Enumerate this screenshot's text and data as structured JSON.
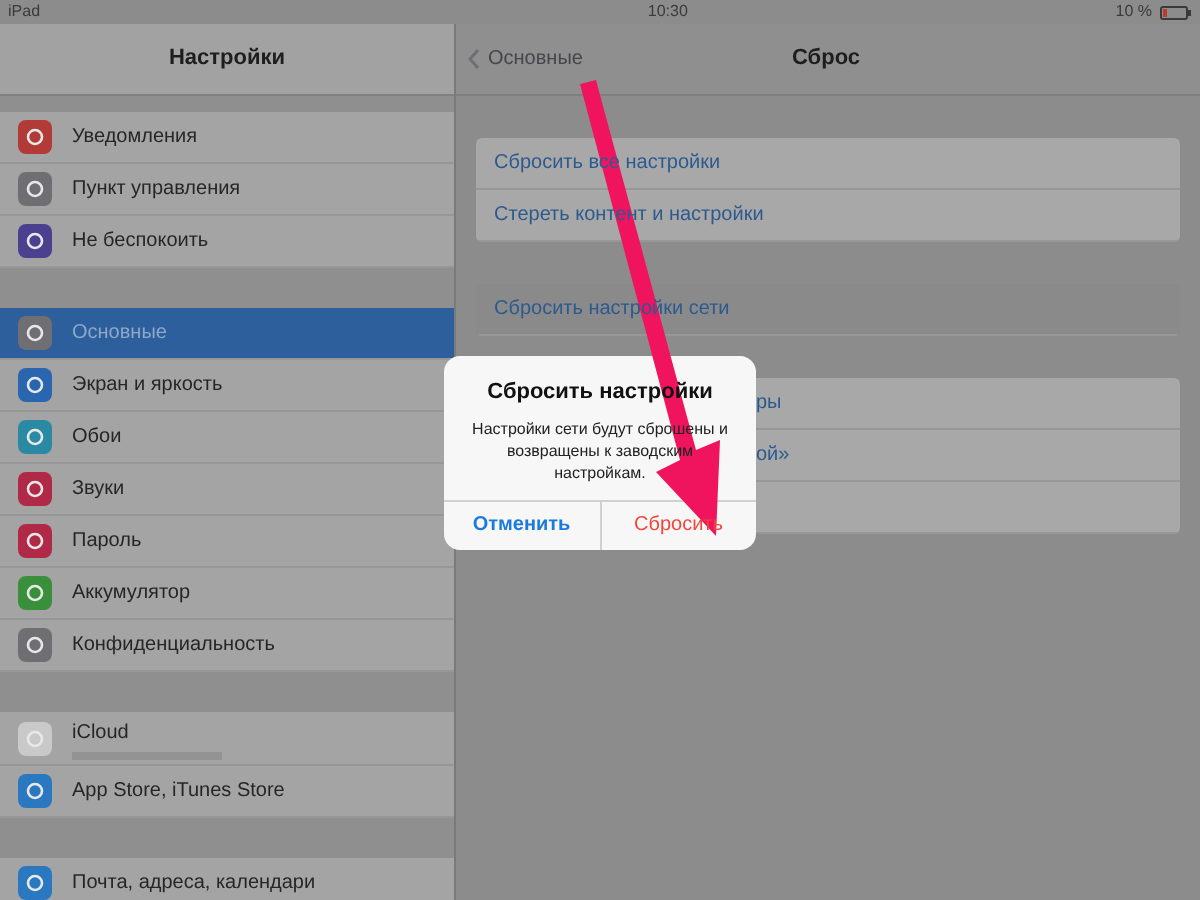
{
  "status_bar": {
    "device": "iPad",
    "time": "10:30",
    "battery": "10 %"
  },
  "sidebar": {
    "title": "Настройки",
    "groups": [
      [
        {
          "label": "Уведомления",
          "selected": false
        },
        {
          "label": "Пункт управления",
          "selected": false
        },
        {
          "label": "Не беспокоить",
          "selected": false
        }
      ],
      [
        {
          "label": "Основные",
          "selected": true
        },
        {
          "label": "Экран и яркость",
          "selected": false
        },
        {
          "label": "Обои",
          "selected": false
        },
        {
          "label": "Звуки",
          "selected": false
        },
        {
          "label": "Пароль",
          "selected": false
        },
        {
          "label": "Аккумулятор",
          "selected": false
        },
        {
          "label": "Конфиденциальность",
          "selected": false
        }
      ],
      [
        {
          "label": "iCloud",
          "selected": false
        },
        {
          "label": "App Store, iTunes Store",
          "selected": false
        }
      ],
      [
        {
          "label": "Почта, адреса, календари",
          "selected": false
        }
      ]
    ]
  },
  "detail": {
    "back": "Основные",
    "title": "Сброс",
    "groups": [
      [
        {
          "label": "Сбросить все настройки",
          "selected": false
        },
        {
          "label": "Стереть контент и настройки",
          "selected": false
        }
      ],
      [
        {
          "label": "Сбросить настройки сети",
          "selected": true
        }
      ],
      [
        {
          "label": "ры",
          "selected": false
        },
        {
          "label": "ой»",
          "selected": false
        },
        {
          "selected": false
        }
      ]
    ]
  },
  "dialog": {
    "title": "Сбросить настройки",
    "message": "Настройки сети будут сброшены и возвращены к заводским настройкам.",
    "buttons": [
      {
        "label": "Отменить",
        "kind": "cancel"
      },
      {
        "label": "Сбросить",
        "kind": "destructive"
      }
    ]
  }
}
